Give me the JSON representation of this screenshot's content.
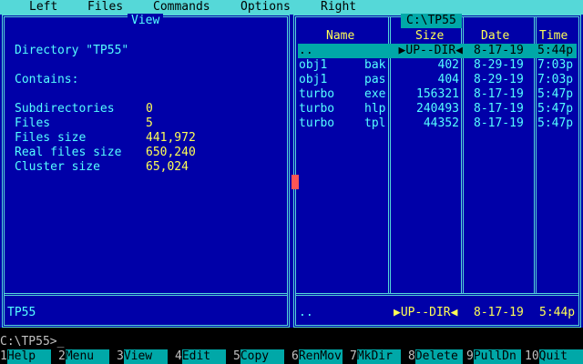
{
  "menu": {
    "items": [
      "Left",
      "Files",
      "Commands",
      "Options",
      "Right"
    ]
  },
  "left_panel": {
    "title": "View",
    "directory_line": "Directory \"TP55\"",
    "contains_label": "Contains:",
    "stats": [
      {
        "label": "Subdirectories",
        "value": "0"
      },
      {
        "label": "Files",
        "value": "5"
      },
      {
        "label": "Files size",
        "value": "441,972"
      },
      {
        "label": "Real files size",
        "value": "650,240"
      },
      {
        "label": "Cluster size",
        "value": "65,024"
      }
    ],
    "footer": "TP55"
  },
  "right_panel": {
    "path": "C:\\TP55",
    "headers": {
      "name": "Name",
      "size": "Size",
      "date": "Date",
      "time": "Time"
    },
    "rows": [
      {
        "name": "..",
        "ext": "",
        "size": "▶UP--DIR◀",
        "date": "8-17-19",
        "time": "5:44p",
        "selected": true
      },
      {
        "name": "obj1",
        "ext": "bak",
        "size": "402",
        "date": "8-29-19",
        "time": "7:03p"
      },
      {
        "name": "obj1",
        "ext": "pas",
        "size": "404",
        "date": "8-29-19",
        "time": "7:03p"
      },
      {
        "name": "turbo",
        "ext": "exe",
        "size": "156321",
        "date": "8-17-19",
        "time": "5:47p"
      },
      {
        "name": "turbo",
        "ext": "hlp",
        "size": "240493",
        "date": "8-17-19",
        "time": "5:47p"
      },
      {
        "name": "turbo",
        "ext": "tpl",
        "size": "44352",
        "date": "8-17-19",
        "time": "5:47p"
      }
    ],
    "footer": {
      "name": "..",
      "size": "▶UP--DIR◀",
      "date": "8-17-19",
      "time": "5:44p"
    }
  },
  "command_line": {
    "prompt": "C:\\TP55>",
    "cursor": "_"
  },
  "keybar": [
    {
      "num": "1",
      "label": "Help"
    },
    {
      "num": "2",
      "label": "Menu"
    },
    {
      "num": "3",
      "label": "View"
    },
    {
      "num": "4",
      "label": "Edit"
    },
    {
      "num": "5",
      "label": "Copy"
    },
    {
      "num": "6",
      "label": "RenMov"
    },
    {
      "num": "7",
      "label": "MkDir"
    },
    {
      "num": "8",
      "label": "Delete"
    },
    {
      "num": "9",
      "label": "PullDn"
    },
    {
      "num": "10",
      "label": "Quit"
    }
  ],
  "colors": {
    "panel_bg": "#0000a8",
    "frame": "#55d8d8",
    "text_cyan": "#55ffff",
    "text_yellow": "#ffff55",
    "selection": "#00a8a8",
    "cursor": "#ff5555"
  }
}
